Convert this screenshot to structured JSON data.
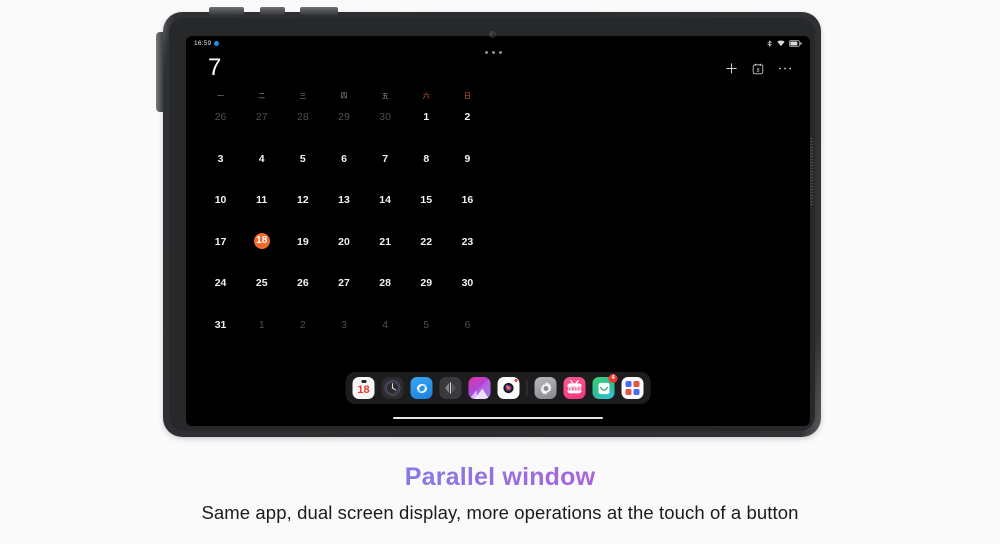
{
  "device": {
    "type": "tablet",
    "frame_color": "#2e3033"
  },
  "status_bar": {
    "time": "16:59",
    "dot_color": "#1a8cf2",
    "icons": [
      "bluetooth-icon",
      "wifi-icon",
      "battery-icon"
    ]
  },
  "window": {
    "drag_handle": "three-dot-handle"
  },
  "calendar": {
    "month_label": "7",
    "actions": [
      {
        "name": "add-event-button",
        "icon": "plus-icon"
      },
      {
        "name": "today-button",
        "icon": "today-calendar-icon"
      },
      {
        "name": "more-options-button",
        "icon": "ellipsis-icon"
      }
    ],
    "weekdays": [
      {
        "label": "一",
        "weekend": false
      },
      {
        "label": "二",
        "weekend": false
      },
      {
        "label": "三",
        "weekend": false
      },
      {
        "label": "四",
        "weekend": false
      },
      {
        "label": "五",
        "weekend": false
      },
      {
        "label": "六",
        "weekend": true
      },
      {
        "label": "日",
        "weekend": true
      }
    ],
    "weekend_color": "#e4622a",
    "today_color": "#f26a2b",
    "today": 18,
    "weeks": [
      [
        {
          "n": "26",
          "dim": true
        },
        {
          "n": "27",
          "dim": true
        },
        {
          "n": "28",
          "dim": true
        },
        {
          "n": "29",
          "dim": true
        },
        {
          "n": "30",
          "dim": true
        },
        {
          "n": "1",
          "dim": false
        },
        {
          "n": "2",
          "dim": false
        }
      ],
      [
        {
          "n": "3",
          "dim": false
        },
        {
          "n": "4",
          "dim": false
        },
        {
          "n": "5",
          "dim": false
        },
        {
          "n": "6",
          "dim": false
        },
        {
          "n": "7",
          "dim": false
        },
        {
          "n": "8",
          "dim": false
        },
        {
          "n": "9",
          "dim": false
        }
      ],
      [
        {
          "n": "10",
          "dim": false
        },
        {
          "n": "11",
          "dim": false
        },
        {
          "n": "12",
          "dim": false
        },
        {
          "n": "13",
          "dim": false
        },
        {
          "n": "14",
          "dim": false
        },
        {
          "n": "15",
          "dim": false
        },
        {
          "n": "16",
          "dim": false
        }
      ],
      [
        {
          "n": "17",
          "dim": false
        },
        {
          "n": "18",
          "dim": false,
          "today": true
        },
        {
          "n": "19",
          "dim": false
        },
        {
          "n": "20",
          "dim": false
        },
        {
          "n": "21",
          "dim": false
        },
        {
          "n": "22",
          "dim": false
        },
        {
          "n": "23",
          "dim": false
        }
      ],
      [
        {
          "n": "24",
          "dim": false
        },
        {
          "n": "25",
          "dim": false
        },
        {
          "n": "26",
          "dim": false
        },
        {
          "n": "27",
          "dim": false
        },
        {
          "n": "28",
          "dim": false
        },
        {
          "n": "29",
          "dim": false
        },
        {
          "n": "30",
          "dim": false
        }
      ],
      [
        {
          "n": "31",
          "dim": false
        },
        {
          "n": "1",
          "dim": true
        },
        {
          "n": "2",
          "dim": true
        },
        {
          "n": "3",
          "dim": true
        },
        {
          "n": "4",
          "dim": true
        },
        {
          "n": "5",
          "dim": true
        },
        {
          "n": "6",
          "dim": true
        }
      ]
    ]
  },
  "dock": {
    "background": "#1d1d1f",
    "apps": [
      {
        "name": "calendar-app-icon",
        "label": "Calendar",
        "day_number": "18"
      },
      {
        "name": "clock-app-icon",
        "label": "Clock"
      },
      {
        "name": "browser-app-icon",
        "label": "Browser"
      },
      {
        "name": "split-screen-app-icon",
        "label": "Split screen"
      },
      {
        "name": "gallery-app-icon",
        "label": "Gallery"
      },
      {
        "name": "camera-app-icon",
        "label": "Camera"
      },
      {
        "name": "settings-app-icon",
        "label": "Settings"
      },
      {
        "name": "bilibili-app-icon",
        "label": "bilibili"
      },
      {
        "name": "mail-app-icon",
        "label": "Mail",
        "badge": "4"
      },
      {
        "name": "app-drawer-icon",
        "label": "All apps"
      }
    ]
  },
  "caption": {
    "title": "Parallel window",
    "subtitle": "Same app, dual screen display, more operations at the touch of a button",
    "title_gradient_from": "#5b9bf0",
    "title_gradient_to": "#e0449c"
  }
}
